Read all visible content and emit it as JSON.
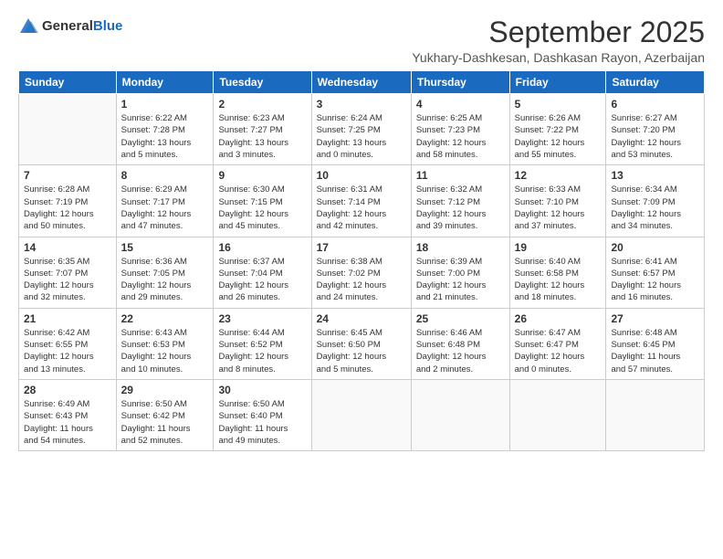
{
  "logo": {
    "general": "General",
    "blue": "Blue"
  },
  "title": "September 2025",
  "subtitle": "Yukhary-Dashkesan, Dashkasan Rayon, Azerbaijan",
  "days_header": [
    "Sunday",
    "Monday",
    "Tuesday",
    "Wednesday",
    "Thursday",
    "Friday",
    "Saturday"
  ],
  "weeks": [
    [
      {
        "day": "",
        "info": ""
      },
      {
        "day": "1",
        "info": "Sunrise: 6:22 AM\nSunset: 7:28 PM\nDaylight: 13 hours\nand 5 minutes."
      },
      {
        "day": "2",
        "info": "Sunrise: 6:23 AM\nSunset: 7:27 PM\nDaylight: 13 hours\nand 3 minutes."
      },
      {
        "day": "3",
        "info": "Sunrise: 6:24 AM\nSunset: 7:25 PM\nDaylight: 13 hours\nand 0 minutes."
      },
      {
        "day": "4",
        "info": "Sunrise: 6:25 AM\nSunset: 7:23 PM\nDaylight: 12 hours\nand 58 minutes."
      },
      {
        "day": "5",
        "info": "Sunrise: 6:26 AM\nSunset: 7:22 PM\nDaylight: 12 hours\nand 55 minutes."
      },
      {
        "day": "6",
        "info": "Sunrise: 6:27 AM\nSunset: 7:20 PM\nDaylight: 12 hours\nand 53 minutes."
      }
    ],
    [
      {
        "day": "7",
        "info": "Sunrise: 6:28 AM\nSunset: 7:19 PM\nDaylight: 12 hours\nand 50 minutes."
      },
      {
        "day": "8",
        "info": "Sunrise: 6:29 AM\nSunset: 7:17 PM\nDaylight: 12 hours\nand 47 minutes."
      },
      {
        "day": "9",
        "info": "Sunrise: 6:30 AM\nSunset: 7:15 PM\nDaylight: 12 hours\nand 45 minutes."
      },
      {
        "day": "10",
        "info": "Sunrise: 6:31 AM\nSunset: 7:14 PM\nDaylight: 12 hours\nand 42 minutes."
      },
      {
        "day": "11",
        "info": "Sunrise: 6:32 AM\nSunset: 7:12 PM\nDaylight: 12 hours\nand 39 minutes."
      },
      {
        "day": "12",
        "info": "Sunrise: 6:33 AM\nSunset: 7:10 PM\nDaylight: 12 hours\nand 37 minutes."
      },
      {
        "day": "13",
        "info": "Sunrise: 6:34 AM\nSunset: 7:09 PM\nDaylight: 12 hours\nand 34 minutes."
      }
    ],
    [
      {
        "day": "14",
        "info": "Sunrise: 6:35 AM\nSunset: 7:07 PM\nDaylight: 12 hours\nand 32 minutes."
      },
      {
        "day": "15",
        "info": "Sunrise: 6:36 AM\nSunset: 7:05 PM\nDaylight: 12 hours\nand 29 minutes."
      },
      {
        "day": "16",
        "info": "Sunrise: 6:37 AM\nSunset: 7:04 PM\nDaylight: 12 hours\nand 26 minutes."
      },
      {
        "day": "17",
        "info": "Sunrise: 6:38 AM\nSunset: 7:02 PM\nDaylight: 12 hours\nand 24 minutes."
      },
      {
        "day": "18",
        "info": "Sunrise: 6:39 AM\nSunset: 7:00 PM\nDaylight: 12 hours\nand 21 minutes."
      },
      {
        "day": "19",
        "info": "Sunrise: 6:40 AM\nSunset: 6:58 PM\nDaylight: 12 hours\nand 18 minutes."
      },
      {
        "day": "20",
        "info": "Sunrise: 6:41 AM\nSunset: 6:57 PM\nDaylight: 12 hours\nand 16 minutes."
      }
    ],
    [
      {
        "day": "21",
        "info": "Sunrise: 6:42 AM\nSunset: 6:55 PM\nDaylight: 12 hours\nand 13 minutes."
      },
      {
        "day": "22",
        "info": "Sunrise: 6:43 AM\nSunset: 6:53 PM\nDaylight: 12 hours\nand 10 minutes."
      },
      {
        "day": "23",
        "info": "Sunrise: 6:44 AM\nSunset: 6:52 PM\nDaylight: 12 hours\nand 8 minutes."
      },
      {
        "day": "24",
        "info": "Sunrise: 6:45 AM\nSunset: 6:50 PM\nDaylight: 12 hours\nand 5 minutes."
      },
      {
        "day": "25",
        "info": "Sunrise: 6:46 AM\nSunset: 6:48 PM\nDaylight: 12 hours\nand 2 minutes."
      },
      {
        "day": "26",
        "info": "Sunrise: 6:47 AM\nSunset: 6:47 PM\nDaylight: 12 hours\nand 0 minutes."
      },
      {
        "day": "27",
        "info": "Sunrise: 6:48 AM\nSunset: 6:45 PM\nDaylight: 11 hours\nand 57 minutes."
      }
    ],
    [
      {
        "day": "28",
        "info": "Sunrise: 6:49 AM\nSunset: 6:43 PM\nDaylight: 11 hours\nand 54 minutes."
      },
      {
        "day": "29",
        "info": "Sunrise: 6:50 AM\nSunset: 6:42 PM\nDaylight: 11 hours\nand 52 minutes."
      },
      {
        "day": "30",
        "info": "Sunrise: 6:50 AM\nSunset: 6:40 PM\nDaylight: 11 hours\nand 49 minutes."
      },
      {
        "day": "",
        "info": ""
      },
      {
        "day": "",
        "info": ""
      },
      {
        "day": "",
        "info": ""
      },
      {
        "day": "",
        "info": ""
      }
    ]
  ]
}
